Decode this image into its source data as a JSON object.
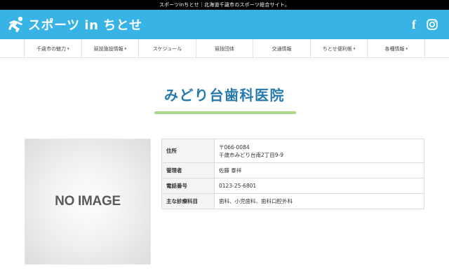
{
  "topbar": {
    "text": "スポーツinちとせ｜北海道千歳市のスポーツ総合サイト。"
  },
  "header": {
    "logo_text": "スポーツ in ちとせ",
    "brand_color": "#37b3e6",
    "social": {
      "facebook_icon": "f"
    }
  },
  "nav": {
    "items": [
      {
        "label": "千歳市の魅力",
        "dropdown": true
      },
      {
        "label": "競技施設情報",
        "dropdown": true
      },
      {
        "label": "スケジュール",
        "dropdown": false
      },
      {
        "label": "競技団体",
        "dropdown": false
      },
      {
        "label": "交通情報",
        "dropdown": false
      },
      {
        "label": "ちとせ便利帳",
        "dropdown": true
      },
      {
        "label": "各種情報",
        "dropdown": true
      }
    ],
    "caret": "▾"
  },
  "page": {
    "title": "みどり台歯科医院",
    "title_color": "#2479ad",
    "rule_color": "#a8d98a"
  },
  "image": {
    "placeholder_text": "NO IMAGE"
  },
  "info": {
    "address_label": "住所",
    "postal": "〒066-0084",
    "address": "千歳市みどり台南2丁目9-9",
    "manager_label": "管理者",
    "manager": "佐藤 泰祥",
    "phone_label": "電話番号",
    "phone": "0123-25-6801",
    "departments_label": "主な診療科目",
    "departments": "歯科、小児歯科、歯科口腔外科"
  }
}
